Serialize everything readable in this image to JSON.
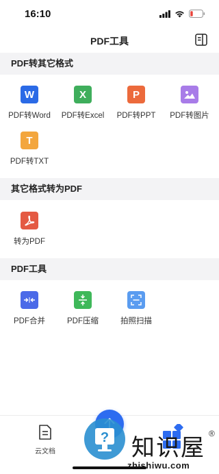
{
  "status_bar": {
    "time": "16:10"
  },
  "nav": {
    "title": "PDF工具"
  },
  "sections": [
    {
      "header": "PDF转其它格式",
      "tools": [
        {
          "label": "PDF转Word",
          "glyph": "W",
          "color": "#2b6ae6",
          "icon": "word-icon"
        },
        {
          "label": "PDF转Excel",
          "glyph": "X",
          "color": "#3fae5c",
          "icon": "excel-icon"
        },
        {
          "label": "PDF转PPT",
          "glyph": "P",
          "color": "#ec6a3c",
          "icon": "ppt-icon"
        },
        {
          "label": "PDF转图片",
          "glyph": "",
          "color": "#a87ce8",
          "icon": "image-icon"
        },
        {
          "label": "PDF转TXT",
          "glyph": "T",
          "color": "#f3a63e",
          "icon": "txt-icon"
        }
      ]
    },
    {
      "header": "其它格式转为PDF",
      "tools": [
        {
          "label": "转为PDF",
          "glyph": "",
          "color": "#e45a43",
          "icon": "acrobat-pdf-icon"
        }
      ]
    },
    {
      "header": "PDF工具",
      "tools": [
        {
          "label": "PDF合并",
          "glyph": "",
          "color": "#4b6ae8",
          "icon": "merge-icon"
        },
        {
          "label": "PDF压缩",
          "glyph": "",
          "color": "#3fb85a",
          "icon": "compress-icon"
        },
        {
          "label": "拍照扫描",
          "glyph": "",
          "color": "#5a9cf0",
          "icon": "scan-icon"
        }
      ]
    }
  ],
  "tab_bar": {
    "docs_label": "云文档"
  },
  "watermark": {
    "text": "知识屋",
    "reg": "®",
    "url": "zhishiwu.com"
  }
}
